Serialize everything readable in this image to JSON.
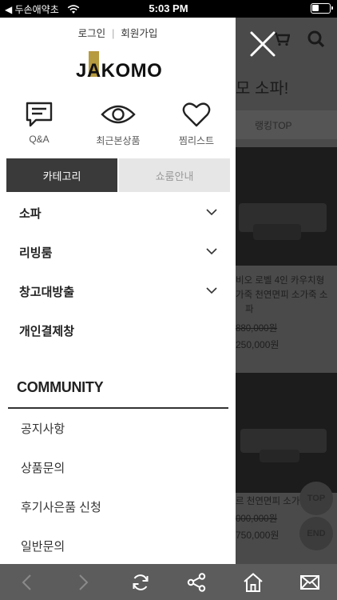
{
  "status_bar": {
    "back_app": "◀ 두손애약초",
    "time": "5:03 PM"
  },
  "drawer": {
    "auth": {
      "login": "로그인",
      "separator": "|",
      "signup": "회원가입"
    },
    "logo": {
      "text": "JAKOMO",
      "accent_color": "#b79b3f"
    },
    "quick_links": [
      {
        "label": "Q&A",
        "icon": "qna-chat-icon"
      },
      {
        "label": "최근본상품",
        "icon": "eye-icon"
      },
      {
        "label": "찜리스트",
        "icon": "heart-icon"
      }
    ],
    "tabs": [
      {
        "label": "카테고리",
        "active": true
      },
      {
        "label": "쇼룸안내",
        "active": false
      }
    ],
    "categories": [
      {
        "label": "소파",
        "expandable": true
      },
      {
        "label": "리빙룸",
        "expandable": true
      },
      {
        "label": "창고대방출",
        "expandable": true
      },
      {
        "label": "개인결제창",
        "expandable": false
      }
    ],
    "community": {
      "heading": "COMMUNITY",
      "items": [
        "공지사항",
        "상품문의",
        "후기사은품 신청",
        "일반문의"
      ]
    }
  },
  "background_page": {
    "title_fragment": "모 소파!",
    "tab_label": "랭킹TOP",
    "product1": {
      "desc_line1": "비오 로벨 4인 카우치형",
      "desc_line2": "가죽 천연면피 소가죽 소",
      "desc_line3": "파",
      "old_price": "880,000원",
      "price": "250,000원"
    },
    "product2": {
      "desc_line1": "르 천연면피 소가죽",
      "old_price": "000,000원",
      "price": "750,000원"
    },
    "top_button": "TOP",
    "end_button": "END"
  },
  "toolbar": {
    "icons": [
      "back-arrow-icon",
      "forward-arrow-icon",
      "refresh-icon",
      "share-icon",
      "home-icon",
      "mail-icon"
    ]
  }
}
